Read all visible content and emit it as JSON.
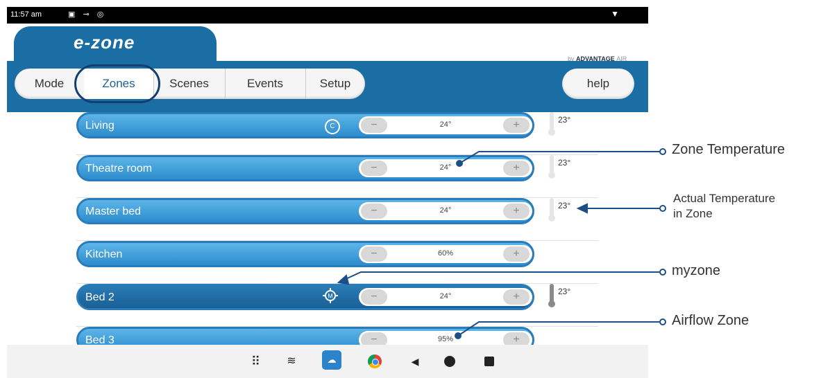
{
  "status_bar": {
    "time": "11:57 am",
    "icons": "▣ ⊸ ◎",
    "wifi_icon": "▼"
  },
  "header": {
    "logo": "e-zone",
    "brand_prefix": "by",
    "brand_name": "ADVANTAGE",
    "brand_suffix": "AIR"
  },
  "nav": {
    "tabs": [
      {
        "label": "Mode"
      },
      {
        "label": "Zones"
      },
      {
        "label": "Scenes"
      },
      {
        "label": "Events"
      },
      {
        "label": "Setup"
      }
    ],
    "selected": "Zones",
    "help": "help"
  },
  "zones": [
    {
      "name": "Living",
      "value": "24°",
      "temp": "23°",
      "badge": "C",
      "minus": "−",
      "plus": "+"
    },
    {
      "name": "Theatre room",
      "value": "24°",
      "temp": "23°",
      "minus": "−",
      "plus": "+"
    },
    {
      "name": "Master bed",
      "value": "24°",
      "temp": "23°",
      "minus": "−",
      "plus": "+"
    },
    {
      "name": "Kitchen",
      "value": "60%",
      "minus": "−",
      "plus": "+"
    },
    {
      "name": "Bed 2",
      "value": "24°",
      "temp": "23°",
      "badge": "M",
      "minus": "−",
      "plus": "+"
    },
    {
      "name": "Bed 3",
      "value": "95%",
      "minus": "−",
      "plus": "+"
    }
  ],
  "annotations": {
    "zone_temperature": "Zone Temperature",
    "actual_temperature_line1": "Actual Temperature",
    "actual_temperature_line2": "in Zone",
    "myzone": "myzone",
    "airflow_zone": "Airflow Zone"
  },
  "colors": {
    "header_blue": "#1a6ea3",
    "zone_light": "#3b9ad8",
    "zone_active": "#1f6aa5",
    "annotation_line": "#1b4f86"
  }
}
